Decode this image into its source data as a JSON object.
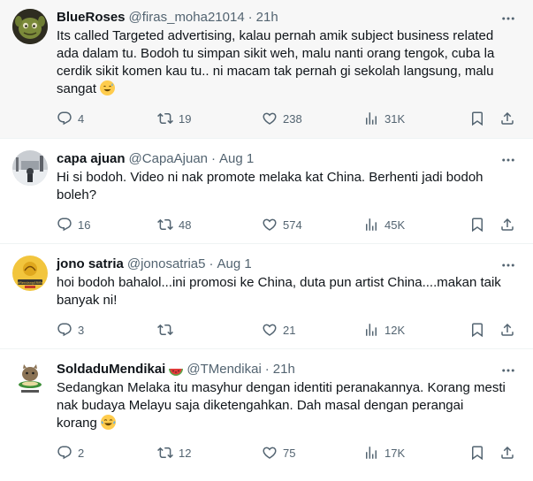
{
  "tweets": [
    {
      "name": "BlueRoses",
      "handle": "@firas_moha21014",
      "time": "21h",
      "text": "Its called Targeted advertising, kalau pernah amik subject business related ada dalam tu. Bodoh tu simpan sikit weh, malu nanti orang tengok, cuba la cerdik sikit komen kau tu.. ni macam tak pernah gi sekolah langsung, malu sangat",
      "emoji": "sweat-smile-emoji",
      "replies": "4",
      "retweets": "19",
      "likes": "238",
      "views": "31K"
    },
    {
      "name": "capa ajuan",
      "handle": "@CapaAjuan",
      "time": "Aug 1",
      "text": "Hi si bodoh. Video ni nak promote melaka kat China. Berhenti jadi bodoh boleh?",
      "replies": "16",
      "retweets": "48",
      "likes": "574",
      "views": "45K"
    },
    {
      "name": "jono satria",
      "handle": "@jonosatria5",
      "time": "Aug 1",
      "text": "hoi bodoh bahalol...ini promosi ke China, duta pun artist China....makan taik banyak ni!",
      "replies": "3",
      "retweets": "",
      "likes": "21",
      "views": "12K"
    },
    {
      "name": "SoldaduMendikai",
      "handle": "@TMendikai",
      "time": "21h",
      "text": "Sedangkan Melaka itu masyhur dengan identiti peranakannya. Korang mesti nak budaya Melayu saja diketengahkan. Dah masal dengan perangai korang",
      "emoji": "tears-of-joy-emoji",
      "replies": "2",
      "retweets": "12",
      "likes": "75",
      "views": "17K"
    }
  ],
  "avatars": {
    "jono_badge_text": "#Rendang4Rifle"
  },
  "colors": {
    "text": "#0f1419",
    "muted": "#536471",
    "divider": "#eff3f4",
    "highlight_bg": "#f7f7f7",
    "emoji_yellow": "#ffcc4d"
  }
}
